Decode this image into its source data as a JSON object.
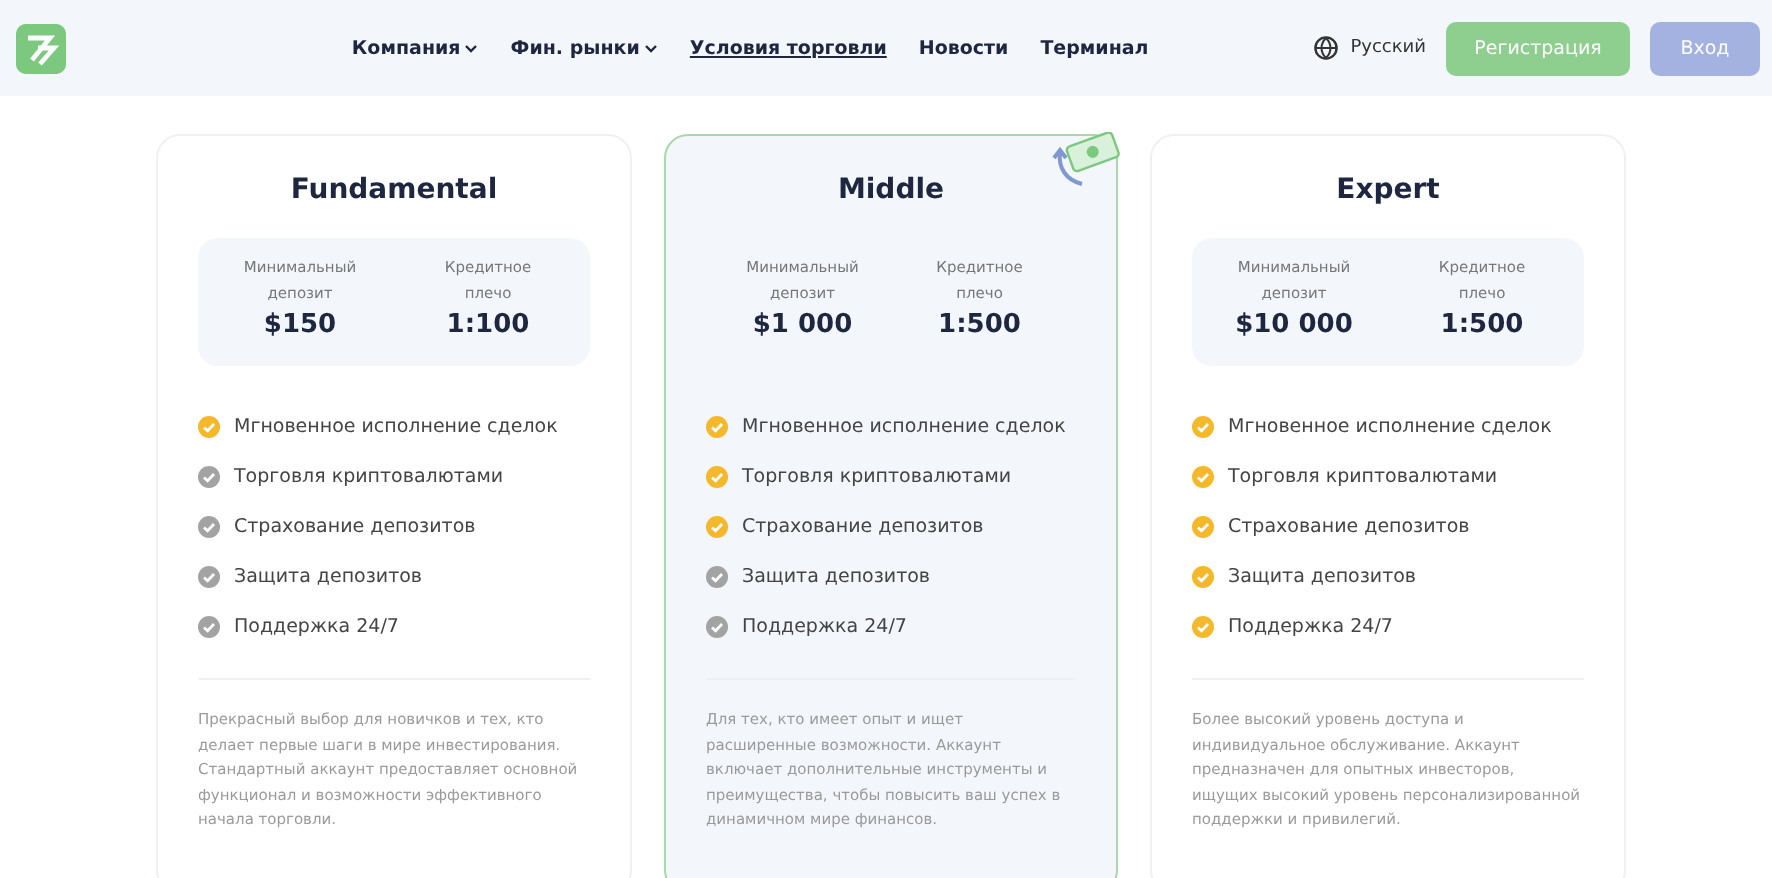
{
  "header": {
    "nav": [
      {
        "label": "Компания",
        "dropdown": true,
        "selected": false
      },
      {
        "label": "Фин. рынки",
        "dropdown": true,
        "selected": false
      },
      {
        "label": "Условия торговли",
        "dropdown": false,
        "selected": true
      },
      {
        "label": "Новости",
        "dropdown": false,
        "selected": false
      },
      {
        "label": "Терминал",
        "dropdown": false,
        "selected": false
      }
    ],
    "language": "Русский",
    "register_button": "Регистрация",
    "login_button": "Вход"
  },
  "plans": [
    {
      "title": "Fundamental",
      "selected": false,
      "stats": [
        {
          "label": "Минимальный депозит",
          "value": "$150"
        },
        {
          "label": "Кредитное плечо",
          "value": "1:100"
        }
      ],
      "features": [
        {
          "text": "Мгновенное исполнение сделок",
          "included": true
        },
        {
          "text": "Торговля криптовалютами",
          "included": false
        },
        {
          "text": "Страхование депозитов",
          "included": false
        },
        {
          "text": "Защита депозитов",
          "included": false
        },
        {
          "text": "Поддержка 24/7",
          "included": false
        }
      ],
      "description": "Прекрасный выбор для новичков и тех, кто делает первые шаги в мире инвестирования. Стандартный аккаунт предоставляет основной функционал и возможности эффективного начала торговли."
    },
    {
      "title": "Middle",
      "selected": true,
      "stats": [
        {
          "label": "Минимальный депозит",
          "value": "$1 000"
        },
        {
          "label": "Кредитное плечо",
          "value": "1:500"
        }
      ],
      "features": [
        {
          "text": "Мгновенное исполнение сделок",
          "included": true
        },
        {
          "text": "Торговля криптовалютами",
          "included": true
        },
        {
          "text": "Страхование депозитов",
          "included": true
        },
        {
          "text": "Защита депозитов",
          "included": false
        },
        {
          "text": "Поддержка 24/7",
          "included": false
        }
      ],
      "description": "Для тех, кто имеет опыт и ищет расширенные возможности. Аккаунт включает дополнительные инструменты и преимущества, чтобы повысить ваш успех в динамичном мире финансов."
    },
    {
      "title": "Expert",
      "selected": false,
      "stats": [
        {
          "label": "Минимальный депозит",
          "value": "$10 000"
        },
        {
          "label": "Кредитное плечо",
          "value": "1:500"
        }
      ],
      "features": [
        {
          "text": "Мгновенное исполнение сделок",
          "included": true
        },
        {
          "text": "Торговля криптовалютами",
          "included": true
        },
        {
          "text": "Страхование депозитов",
          "included": true
        },
        {
          "text": "Защита депозитов",
          "included": true
        },
        {
          "text": "Поддержка 24/7",
          "included": true
        }
      ],
      "description": "Более высокий уровень доступа и индивидуальное обслуживание. Аккаунт предназначен для опытных инвесторов, ищущих высокий уровень персонализированной поддержки и привилегий."
    }
  ]
}
